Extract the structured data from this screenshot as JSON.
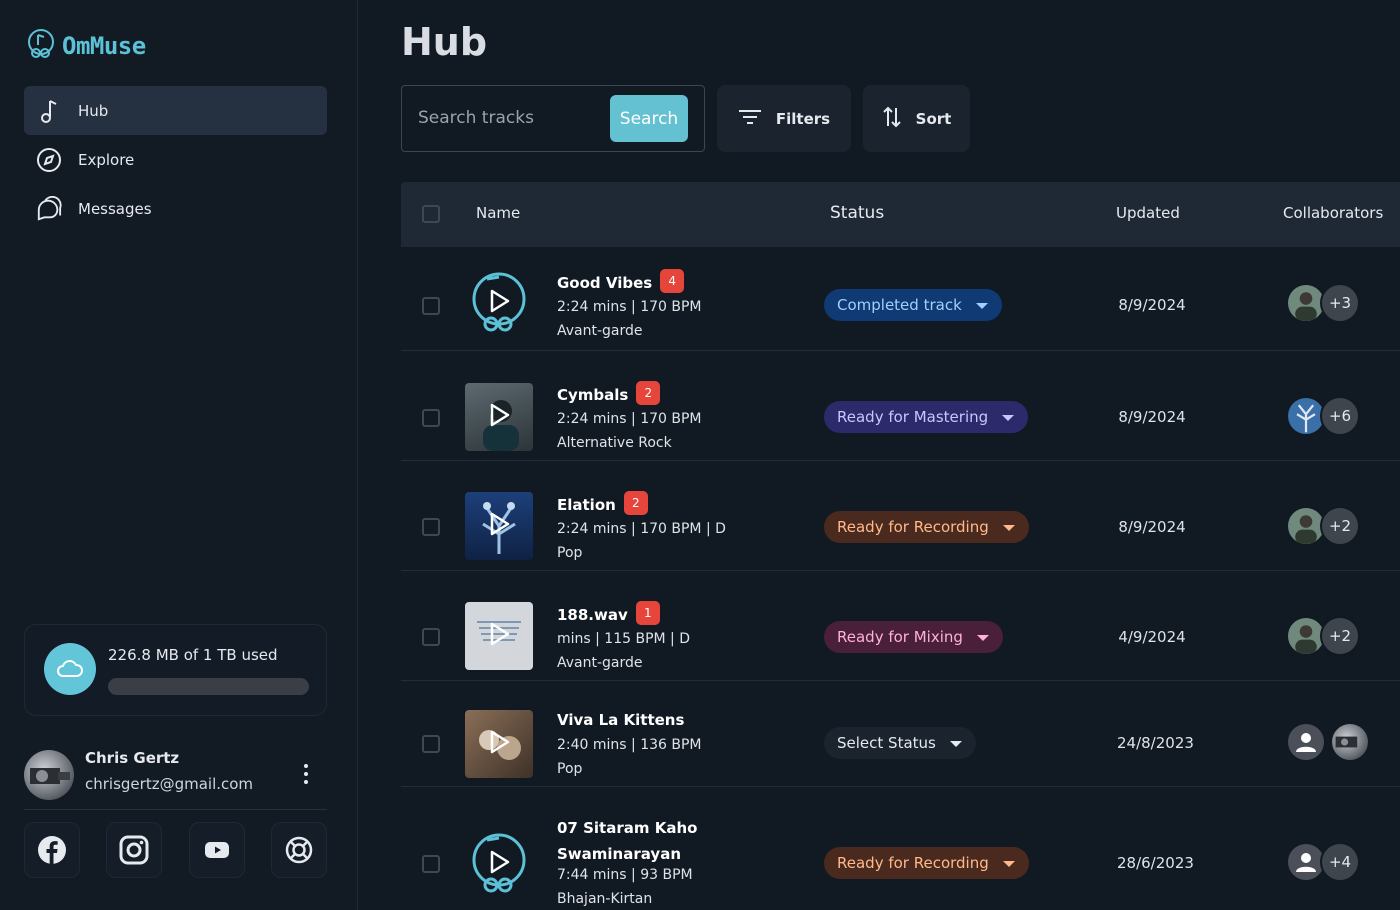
{
  "brand": {
    "name": "OmMuse",
    "color": "#5cc1d6"
  },
  "nav": [
    {
      "label": "Hub",
      "icon": "music-note-icon",
      "active": true
    },
    {
      "label": "Explore",
      "icon": "compass-icon",
      "active": false
    },
    {
      "label": "Messages",
      "icon": "chat-bubbles-icon",
      "active": false
    }
  ],
  "storage": {
    "label": "226.8 MB of 1 TB used",
    "used_fraction": 0.0002,
    "icon": "cloud-icon"
  },
  "user": {
    "name": "Chris Gertz",
    "email": "chrisgertz@gmail.com",
    "menu_icon": "more-vertical-icon"
  },
  "socials": [
    "facebook-icon",
    "instagram-icon",
    "youtube-icon",
    "support-lifebuoy-icon"
  ],
  "page": {
    "title": "Hub"
  },
  "search": {
    "placeholder": "Search tracks",
    "value": "",
    "button": "Search"
  },
  "toolbar": {
    "filters_label": "Filters",
    "sort_label": "Sort"
  },
  "table": {
    "columns": {
      "name": "Name",
      "status": "Status",
      "updated": "Updated",
      "collaborators": "Collaborators"
    },
    "rows": [
      {
        "name": "Good Vibes",
        "badge": "4",
        "meta": "2:24 mins | 170 BPM",
        "genre": "Avant-garde",
        "status": "Completed track",
        "status_kind": "completed",
        "updated": "8/9/2024",
        "collab_more": "+3",
        "thumb": "logo"
      },
      {
        "name": "Cymbals",
        "badge": "2",
        "meta": "2:24 mins | 170 BPM",
        "genre": "Alternative Rock",
        "status": "Ready for Mastering",
        "status_kind": "mastering",
        "updated": "8/9/2024",
        "collab_more": "+6",
        "thumb": "photo-man"
      },
      {
        "name": "Elation",
        "badge": "2",
        "meta": "2:24 mins | 170 BPM | D",
        "genre": "Pop",
        "status": "Ready for Recording",
        "status_kind": "recording",
        "updated": "8/9/2024",
        "collab_more": "+2",
        "thumb": "photo-blue"
      },
      {
        "name": "188.wav",
        "badge": "1",
        "meta": "mins | 115 BPM | D",
        "genre": "Avant-garde",
        "status": "Ready for Mixing",
        "status_kind": "mixing",
        "updated": "4/9/2024",
        "collab_more": "+2",
        "thumb": "photo-light"
      },
      {
        "name": "Viva La Kittens",
        "badge": "",
        "meta": "2:40 mins | 136 BPM",
        "genre": "Pop",
        "status": "Select Status",
        "status_kind": "none",
        "updated": "24/8/2023",
        "collab_more": "",
        "thumb": "photo-cats"
      },
      {
        "name": "07 Sitaram Kaho Swaminarayan",
        "badge": "",
        "meta": "7:44 mins | 93 BPM",
        "genre": "Bhajan-Kirtan",
        "status": "Ready for Recording",
        "status_kind": "recording",
        "updated": "28/6/2023",
        "collab_more": "+4",
        "thumb": "logo"
      }
    ]
  },
  "colors": {
    "accent": "#63c1d1",
    "badge": "#e5453a",
    "status_completed_bg": "#0f3a73",
    "status_completed_fg": "#9fd0ff",
    "status_mastering_bg": "#2c2a6b",
    "status_mastering_fg": "#c9c6ff",
    "status_recording_bg": "#4a2a1e",
    "status_recording_fg": "#ffb98a",
    "status_mixing_bg": "#4a1f3a",
    "status_mixing_fg": "#ffb1d8",
    "status_none_bg": "#1a232e",
    "status_none_fg": "#e6e9ee"
  }
}
